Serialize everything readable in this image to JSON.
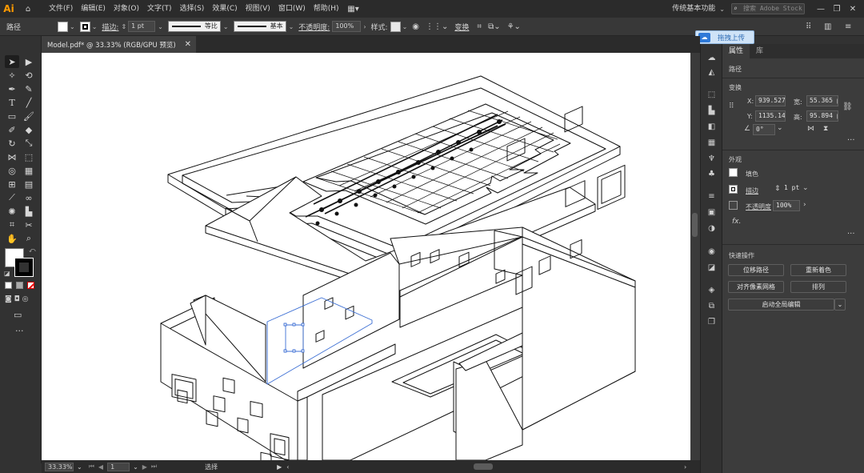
{
  "app": {
    "logo": "Ai",
    "workspace": "传统基本功能",
    "search_placeholder": "搜索 Adobe Stock"
  },
  "menu": [
    "文件(F)",
    "编辑(E)",
    "对象(O)",
    "文字(T)",
    "选择(S)",
    "效果(C)",
    "视图(V)",
    "窗口(W)",
    "帮助(H)"
  ],
  "control_bar": {
    "selection_label": "路径",
    "stroke_label": "描边:",
    "stroke_weight": "1 pt",
    "profile_label": "等比",
    "brush_label": "基本",
    "opacity_label": "不透明度:",
    "opacity_value": "100%",
    "style_label": "样式:",
    "transform_label": "变换"
  },
  "upload_button": "拖拽上传",
  "document": {
    "tab_title": "Model.pdf* @ 33.33% (RGB/GPU 预览)"
  },
  "status_bar": {
    "zoom": "33.33%",
    "artboard": "1",
    "tool": "选择"
  },
  "panel": {
    "tabs": [
      "属性",
      "库"
    ],
    "selection_type": "路径",
    "transform": {
      "title": "变换",
      "x_label": "X:",
      "x_value": "939.527",
      "y_label": "Y:",
      "y_value": "1135.142",
      "w_label": "宽:",
      "w_value": "55.365 p",
      "h_label": "高:",
      "h_value": "95.894 p",
      "angle_value": "0°"
    },
    "appearance": {
      "title": "外观",
      "fill_label": "填色",
      "stroke_label": "描边",
      "stroke_value": "1 pt",
      "opacity_label": "不透明度",
      "opacity_value": "100%",
      "fx_label": "fx."
    },
    "quick_actions": {
      "title": "快速操作",
      "offset_path": "位移路径",
      "recolor": "重新着色",
      "align_pixel": "对齐像素网格",
      "arrange": "排列",
      "global_edit": "启动全局编辑"
    }
  }
}
